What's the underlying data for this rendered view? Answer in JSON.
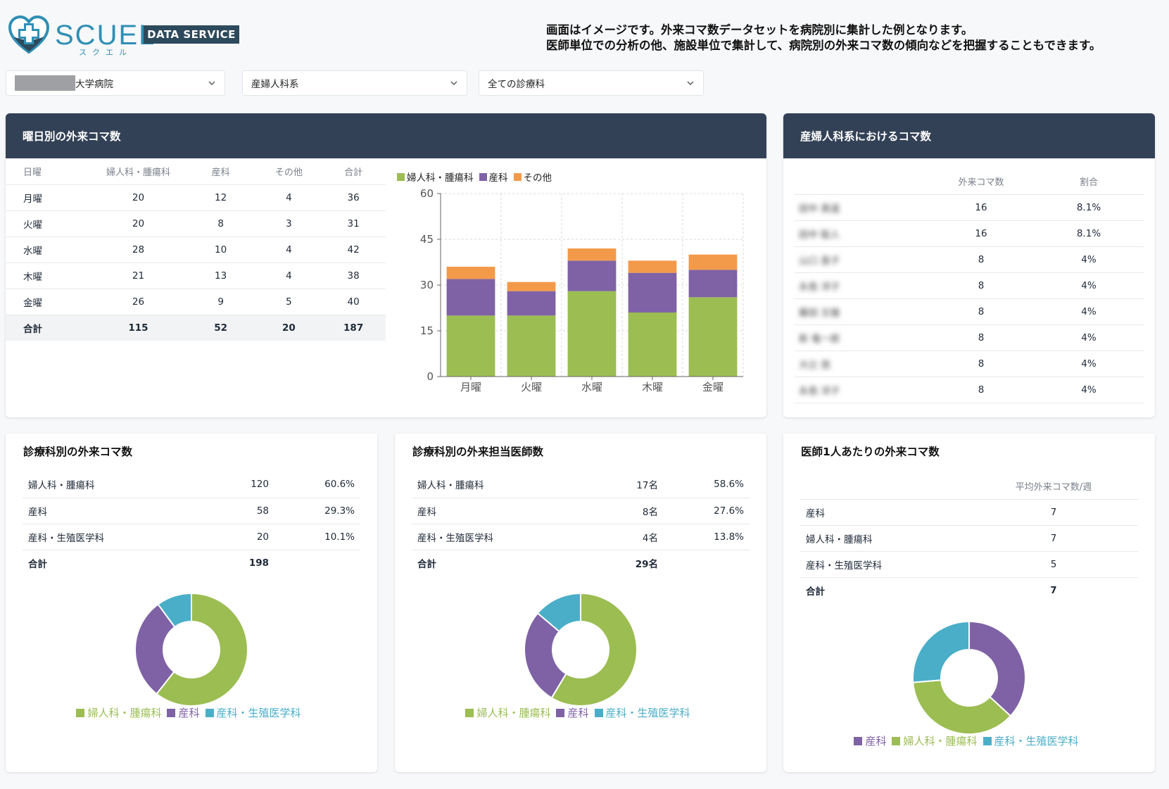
{
  "header": {
    "logo_text": "SCUEL",
    "logo_kana": "スクエル",
    "logo_badge": "DATA SERVICE",
    "notice_line1": "画面はイメージです。外来コマ数データセットを病院別に集計した例となります。",
    "notice_line2": "医師単位での分析の他、施設単位で集計して、病院別の外来コマ数の傾向などを把握することもできます。"
  },
  "filters": {
    "hospital": "大学病院",
    "department_group": "産婦人科系",
    "department": "全ての診療科"
  },
  "colors": {
    "green": "#9bbd52",
    "purple": "#7f62a5",
    "orange": "#f39a4a",
    "teal": "#4aaec8",
    "header_bg": "#334156"
  },
  "weekday_card": {
    "title": "曜日別の外来コマ数",
    "columns": [
      "日曜",
      "婦人科・腫瘍科",
      "産科",
      "その他",
      "合計"
    ],
    "rows": [
      [
        "月曜",
        "20",
        "12",
        "4",
        "36"
      ],
      [
        "火曜",
        "20",
        "8",
        "3",
        "31"
      ],
      [
        "水曜",
        "28",
        "10",
        "4",
        "42"
      ],
      [
        "木曜",
        "21",
        "13",
        "4",
        "38"
      ],
      [
        "金曜",
        "26",
        "9",
        "5",
        "40"
      ]
    ],
    "total": [
      "合計",
      "115",
      "52",
      "20",
      "187"
    ]
  },
  "chart_data": [
    {
      "type": "bar",
      "stacked": true,
      "categories": [
        "月曜",
        "火曜",
        "水曜",
        "木曜",
        "金曜"
      ],
      "series": [
        {
          "name": "婦人科・腫瘍科",
          "color": "#9bbd52",
          "values": [
            20,
            20,
            28,
            21,
            26
          ]
        },
        {
          "name": "産科",
          "color": "#7f62a5",
          "values": [
            12,
            8,
            10,
            13,
            9
          ]
        },
        {
          "name": "その他",
          "color": "#f39a4a",
          "values": [
            4,
            3,
            4,
            4,
            5
          ]
        }
      ],
      "ylim": [
        0,
        60
      ],
      "yticks": [
        0,
        15,
        30,
        45,
        60
      ],
      "grid": true,
      "legend": "top-left"
    },
    {
      "type": "pie",
      "donut": true,
      "labels": [
        "婦人科・腫瘍科",
        "産科",
        "産科・生殖医学科"
      ],
      "values": [
        120,
        58,
        20
      ],
      "colors": [
        "#9bbd52",
        "#7f62a5",
        "#4aaec8"
      ],
      "legend": "bottom"
    },
    {
      "type": "pie",
      "donut": true,
      "labels": [
        "婦人科・腫瘍科",
        "産科",
        "産科・生殖医学科"
      ],
      "values": [
        17,
        8,
        4
      ],
      "colors": [
        "#9bbd52",
        "#7f62a5",
        "#4aaec8"
      ],
      "legend": "bottom"
    },
    {
      "type": "pie",
      "donut": true,
      "labels": [
        "産科",
        "婦人科・腫瘍科",
        "産科・生殖医学科"
      ],
      "values": [
        7,
        7,
        5
      ],
      "colors": [
        "#7f62a5",
        "#9bbd52",
        "#4aaec8"
      ],
      "legend": "bottom"
    }
  ],
  "obgyn_card": {
    "title": "産婦人科系におけるコマ数",
    "columns": [
      "",
      "外来コマ数",
      "割合"
    ],
    "rows": [
      [
        "田中 真遥",
        "16",
        "8.1%"
      ],
      [
        "田中 聡人",
        "16",
        "8.1%"
      ],
      [
        "山口 直子",
        "8",
        "4%"
      ],
      [
        "永島 洋子",
        "8",
        "4%"
      ],
      [
        "藤田 文雄",
        "8",
        "4%"
      ],
      [
        "新 竜一郎",
        "8",
        "4%"
      ],
      [
        "大辻 悠",
        "8",
        "4%"
      ],
      [
        "永島 洋子",
        "8",
        "4%"
      ]
    ]
  },
  "dept_slots_card": {
    "title": "診療科別の外来コマ数",
    "rows": [
      [
        "婦人科・腫瘍科",
        "120",
        "60.6%"
      ],
      [
        "産科",
        "58",
        "29.3%"
      ],
      [
        "産科・生殖医学科",
        "20",
        "10.1%"
      ]
    ],
    "total": [
      "合計",
      "198",
      ""
    ]
  },
  "dept_doctors_card": {
    "title": "診療科別の外来担当医師数",
    "rows": [
      [
        "婦人科・腫瘍科",
        "17名",
        "58.6%"
      ],
      [
        "産科",
        "8名",
        "27.6%"
      ],
      [
        "産科・生殖医学科",
        "4名",
        "13.8%"
      ]
    ],
    "total": [
      "合計",
      "29名",
      ""
    ]
  },
  "per_doctor_card": {
    "title": "医師1人あたりの外来コマ数",
    "column": "平均外来コマ数/週",
    "rows": [
      [
        "産科",
        "7"
      ],
      [
        "婦人科・腫瘍科",
        "7"
      ],
      [
        "産科・生殖医学科",
        "5"
      ]
    ],
    "total": [
      "合計",
      "7"
    ]
  }
}
